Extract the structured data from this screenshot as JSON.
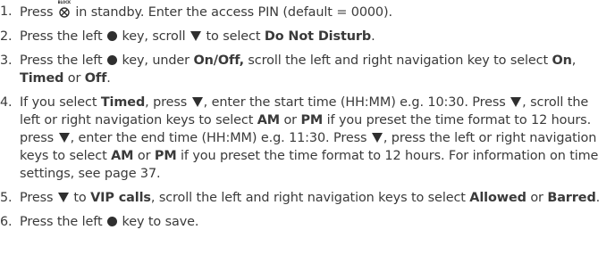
{
  "steps": [
    {
      "num": "1.",
      "t1": "Press ",
      "icon_label": "BLOCK",
      "t2": " in standby. Enter the access PIN (default = 0000)."
    },
    {
      "num": "2.",
      "t1": "Press the left ",
      "t2": " key, scroll ",
      "t3": " to select ",
      "b1": "Do Not Disturb",
      "t4": "."
    },
    {
      "num": "3.",
      "t1": "Press the left ",
      "t2": " key, under ",
      "b1": "On/Off,",
      "t3": " scroll the left and right navigation key to select ",
      "b2": "On",
      "t4": ", ",
      "b3": "Timed",
      "t5": " or ",
      "b4": "Off",
      "t6": "."
    },
    {
      "num": "4.",
      "t1": "If you select ",
      "b1": "Timed",
      "t2": ", press ",
      "t3": ", enter the start time (HH:MM) e.g. 10:30. Press ",
      "t4": ", scroll the left or right navigation keys to select ",
      "b2": "AM",
      "t5": " or ",
      "b3": "PM",
      "t6": " if you preset the time format to 12 hours. press ",
      "t7": ", enter the end time (HH:MM) e.g. 11:30. Press ",
      "t8": ", press the left or right navigation keys to select ",
      "b4": "AM",
      "t9": " or ",
      "b5": "PM",
      "t10": " if you preset the time format to 12 hours. For information on time settings, see page 37."
    },
    {
      "num": "5.",
      "t1": "Press ",
      "t2": " to ",
      "b1": "VIP calls",
      "t3": ", scroll the left and right navigation keys to select ",
      "b2": "Allowed",
      "t4": " or ",
      "b3": "Barred",
      "t5": "."
    },
    {
      "num": "6.",
      "t1": "Press the left ",
      "t2": " key to save."
    }
  ],
  "icons": {
    "block": "block-key-icon",
    "left_key": "left-softkey-dot-icon",
    "down": "down-arrow-icon"
  }
}
